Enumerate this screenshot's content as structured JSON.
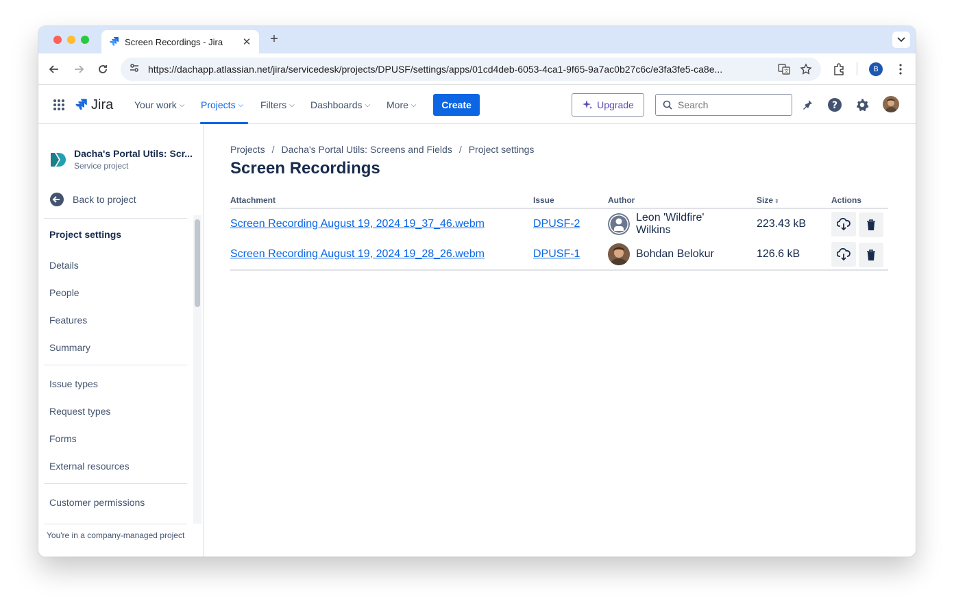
{
  "browser": {
    "tab_title": "Screen Recordings - Jira",
    "url": "https://dachapp.atlassian.net/jira/servicedesk/projects/DPUSF/settings/apps/01cd4deb-6053-4ca1-9f65-9a7ac0b27c6c/e3fa3fe5-ca8e...",
    "profile_initial": "B"
  },
  "topnav": {
    "logo_text": "Jira",
    "items": [
      "Your work",
      "Projects",
      "Filters",
      "Dashboards",
      "More"
    ],
    "create_label": "Create",
    "upgrade_label": "Upgrade",
    "search_placeholder": "Search"
  },
  "sidebar": {
    "project_name": "Dacha's Portal Utils: Scr...",
    "project_type": "Service project",
    "back_label": "Back to project",
    "heading": "Project settings",
    "group1": [
      "Details",
      "People",
      "Features",
      "Summary"
    ],
    "group2": [
      "Issue types",
      "Request types",
      "Forms",
      "External resources"
    ],
    "group3": [
      "Customer permissions"
    ],
    "footer": "You're in a company-managed project"
  },
  "main": {
    "breadcrumbs": [
      "Projects",
      "Dacha's Portal Utils: Screens and Fields",
      "Project settings"
    ],
    "title": "Screen Recordings",
    "columns": [
      "Attachment",
      "Issue",
      "Author",
      "Size",
      "Actions"
    ],
    "rows": [
      {
        "attachment": "Screen Recording August 19, 2024 19_37_46.webm",
        "issue": "DPUSF-2",
        "author_line1": "Leon 'Wildfire'",
        "author_line2": "Wilkins",
        "size": "223.43 kB"
      },
      {
        "attachment": "Screen Recording August 19, 2024 19_28_26.webm",
        "issue": "DPUSF-1",
        "author_line1": "Bohdan Belokur",
        "author_line2": "",
        "size": "126.6 kB"
      }
    ]
  },
  "colors": {
    "accent": "#0c66e4",
    "tabstrip": "#d9e5f8",
    "text": "#172b4d"
  }
}
